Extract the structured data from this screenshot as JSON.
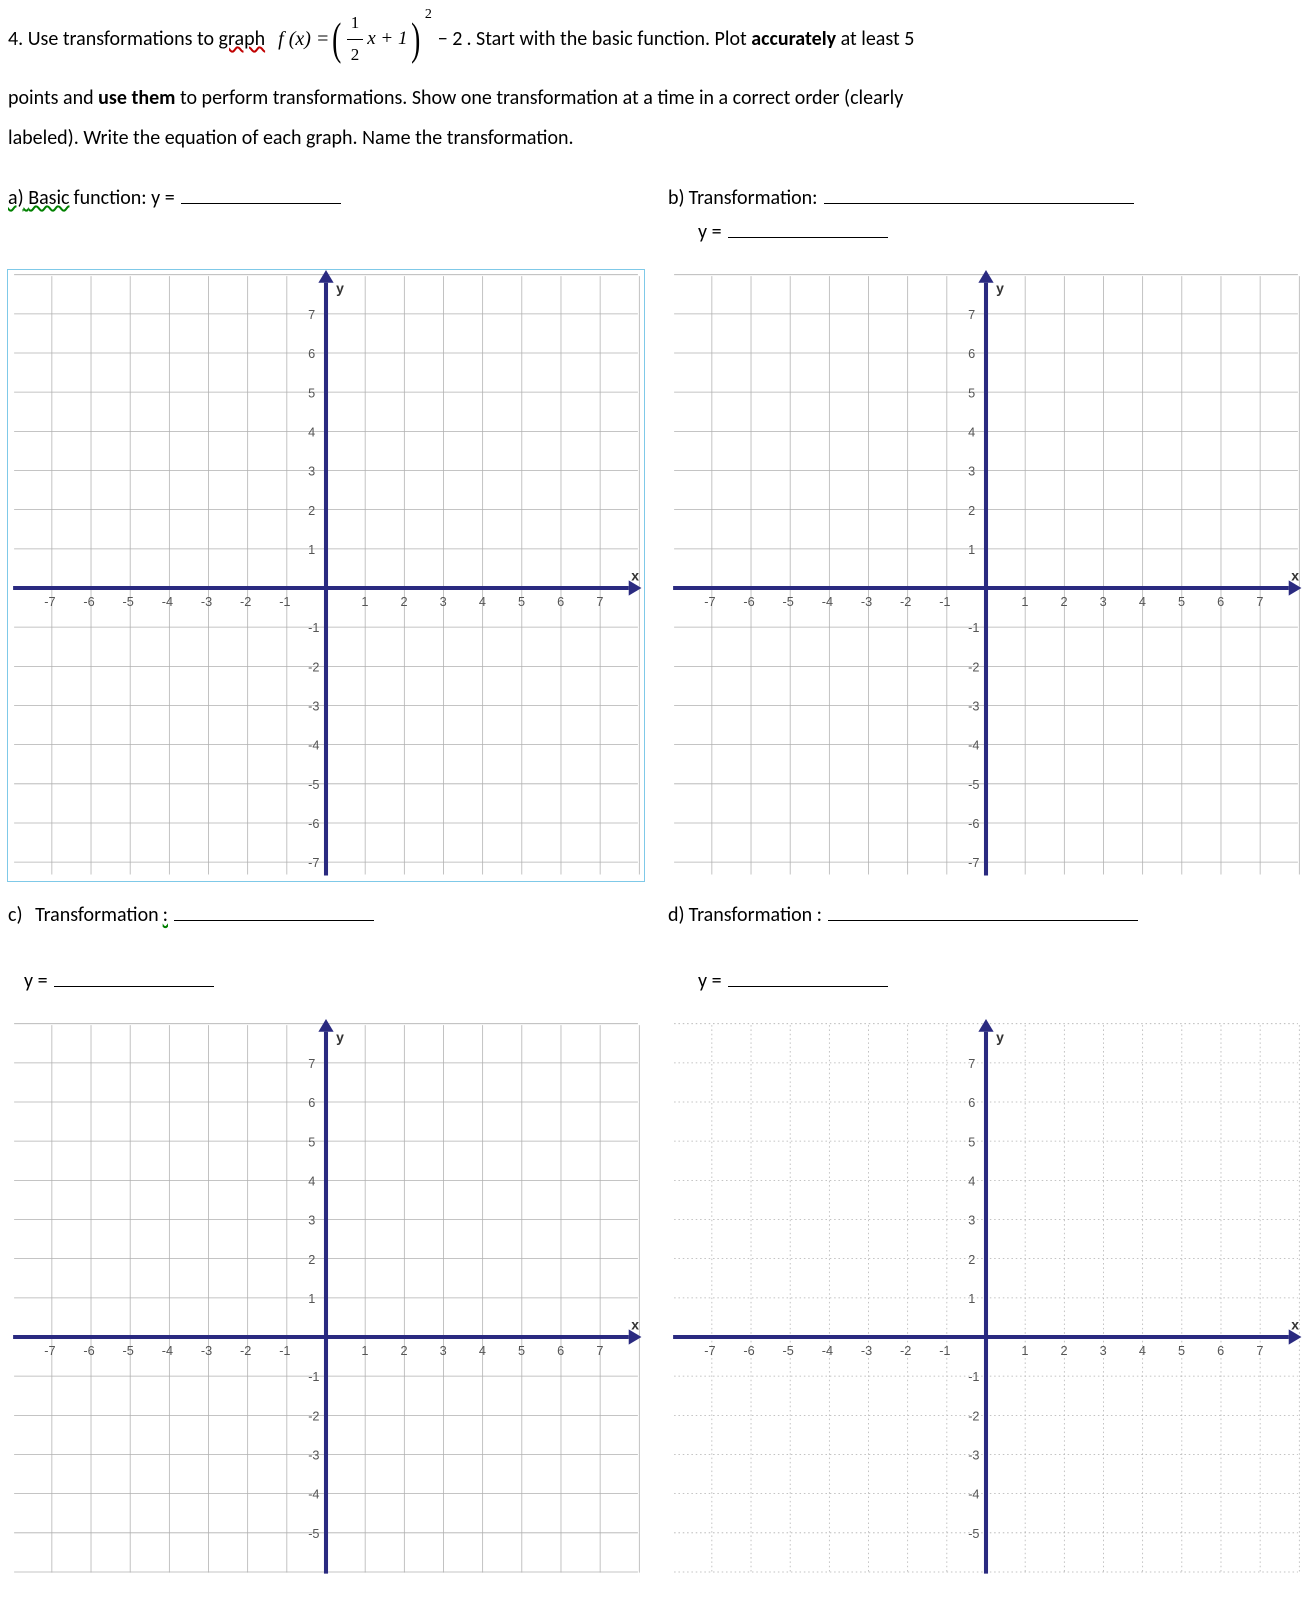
{
  "problem_number": "4.",
  "instructions": {
    "pre_equation": "Use transformations to",
    "word_graph": "graph",
    "equation": {
      "lhs": "f (x) =",
      "frac_num": "1",
      "frac_den": "2",
      "x_term": "x + 1",
      "exponent": "2",
      "tail": "− 2"
    },
    "post_equation": ". Start with the basic function. Plot",
    "word_accurately": "accurately",
    "post_accurately": "at least 5",
    "line2_a": "points and",
    "line2_use_them": "use them",
    "line2_b": "to perform transformations. Show one transformation at a time in a correct order (clearly",
    "line3": "labeled). Write the equation of each graph. Name the transformation."
  },
  "parts": {
    "a": {
      "letter": "a)",
      "label_word": "Basic",
      "label_rest": "function:  y ="
    },
    "b": {
      "letter": "b)",
      "label": "Transformation:",
      "yeq": "y ="
    },
    "c": {
      "letter": "c)",
      "label": "Transformation",
      "colon": ":",
      "yeq": "y ="
    },
    "d": {
      "letter": "d)",
      "label": "Transformation :",
      "yeq": "y ="
    }
  },
  "graph": {
    "x_min": -7,
    "x_max": 7,
    "y_min": -7,
    "y_max": 7,
    "x_ticks": [
      -7,
      -6,
      -5,
      -4,
      -3,
      -2,
      -1,
      1,
      2,
      3,
      4,
      5,
      6,
      7
    ],
    "y_ticks": [
      -7,
      -6,
      -5,
      -4,
      -3,
      -2,
      -1,
      1,
      2,
      3,
      4,
      5,
      6,
      7
    ],
    "x_label": "x",
    "y_label": "y"
  },
  "chart_data": [
    {
      "type": "scatter",
      "title": "a) Basic function",
      "x": [],
      "y": [],
      "xlim": [
        -7,
        7
      ],
      "ylim": [
        -7,
        7
      ]
    },
    {
      "type": "scatter",
      "title": "b) Transformation",
      "x": [],
      "y": [],
      "xlim": [
        -7,
        7
      ],
      "ylim": [
        -7,
        7
      ]
    },
    {
      "type": "scatter",
      "title": "c) Transformation",
      "x": [],
      "y": [],
      "xlim": [
        -7,
        7
      ],
      "ylim": [
        -7,
        7
      ]
    },
    {
      "type": "scatter",
      "title": "d) Transformation",
      "x": [],
      "y": [],
      "xlim": [
        -7,
        7
      ],
      "ylim": [
        -7,
        7
      ]
    }
  ]
}
